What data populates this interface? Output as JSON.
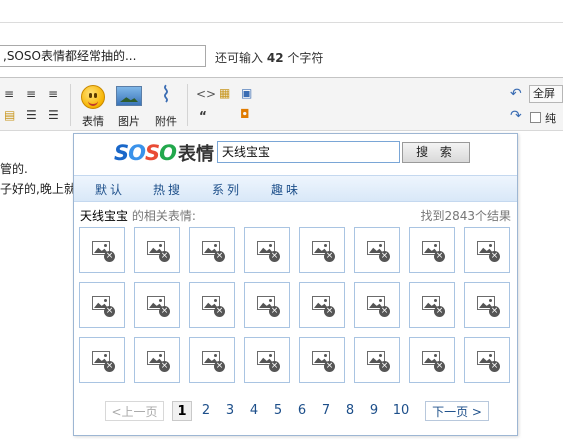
{
  "post": {
    "title_value": ",SOSO表情都经常抽的...",
    "remain_prefix": "还可输入",
    "remain_count": "42",
    "remain_suffix": "个字符"
  },
  "toolbar": {
    "emoticon_label": "表情",
    "image_label": "图片",
    "attachment_label": "附件",
    "fullscreen_label": "全屏",
    "plain_label": "纯"
  },
  "editor": {
    "line1": "管的.",
    "line2": "子好的,晚上就"
  },
  "emoticon_panel": {
    "logo_soso": "SOSO",
    "logo_word": "表情",
    "search_value": "天线宝宝",
    "search_button": "搜 索",
    "tabs": [
      "默认",
      "热搜",
      "系列",
      "趣味"
    ],
    "result_keyword": "天线宝宝",
    "result_suffix": " 的相关表情:",
    "result_count": "找到2843个结果",
    "pagination": {
      "prev": "<上一页",
      "pages": [
        "1",
        "2",
        "3",
        "4",
        "5",
        "6",
        "7",
        "8",
        "9",
        "10"
      ],
      "current": "1",
      "next": "下一页 >"
    }
  }
}
